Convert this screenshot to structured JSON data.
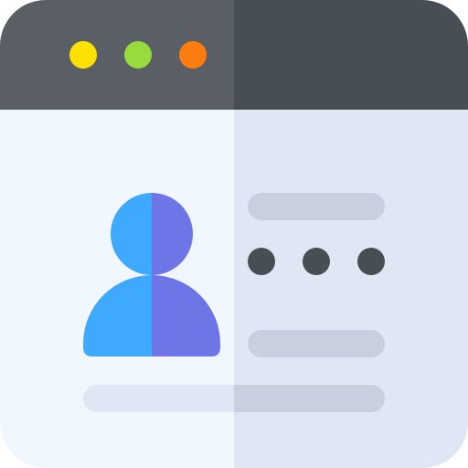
{
  "icon": {
    "name": "user-profile-login-window-icon",
    "window": {
      "controls": [
        {
          "name": "window-dot-yellow",
          "color": "#FFE100"
        },
        {
          "name": "window-dot-green",
          "color": "#97DC3C"
        },
        {
          "name": "window-dot-orange",
          "color": "#FF7D0F"
        }
      ],
      "titlebar_left_color": "#5A5F66",
      "titlebar_right_color": "#474F54",
      "body_left_color": "#F0F7FF",
      "body_right_color": "#DFE7F4"
    },
    "avatar": {
      "left_color": "#3FA9FF",
      "right_color": "#6E75E6"
    },
    "content": {
      "line_color": "#C9CFDF",
      "footer_line_left_color": "#DFE6F4",
      "footer_line_right_color": "#C9CFDF",
      "password_dot_color": "#474F54",
      "password_dot_count": 3
    }
  }
}
